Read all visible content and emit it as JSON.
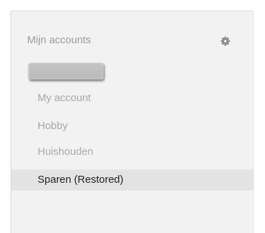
{
  "sidebar": {
    "header_title": "Mijn accounts",
    "settings_icon": "gear-icon",
    "items": [
      {
        "label": "My account"
      },
      {
        "label": "Hobby"
      },
      {
        "label": "Huishouden"
      },
      {
        "label": "Sparen (Restored)",
        "active": true
      }
    ]
  },
  "colors": {
    "panel_background": "#f2f2f2",
    "active_item_background": "#e3e3e3",
    "active_item_text": "#222222",
    "inactive_item_text": "#a5a5a5"
  }
}
